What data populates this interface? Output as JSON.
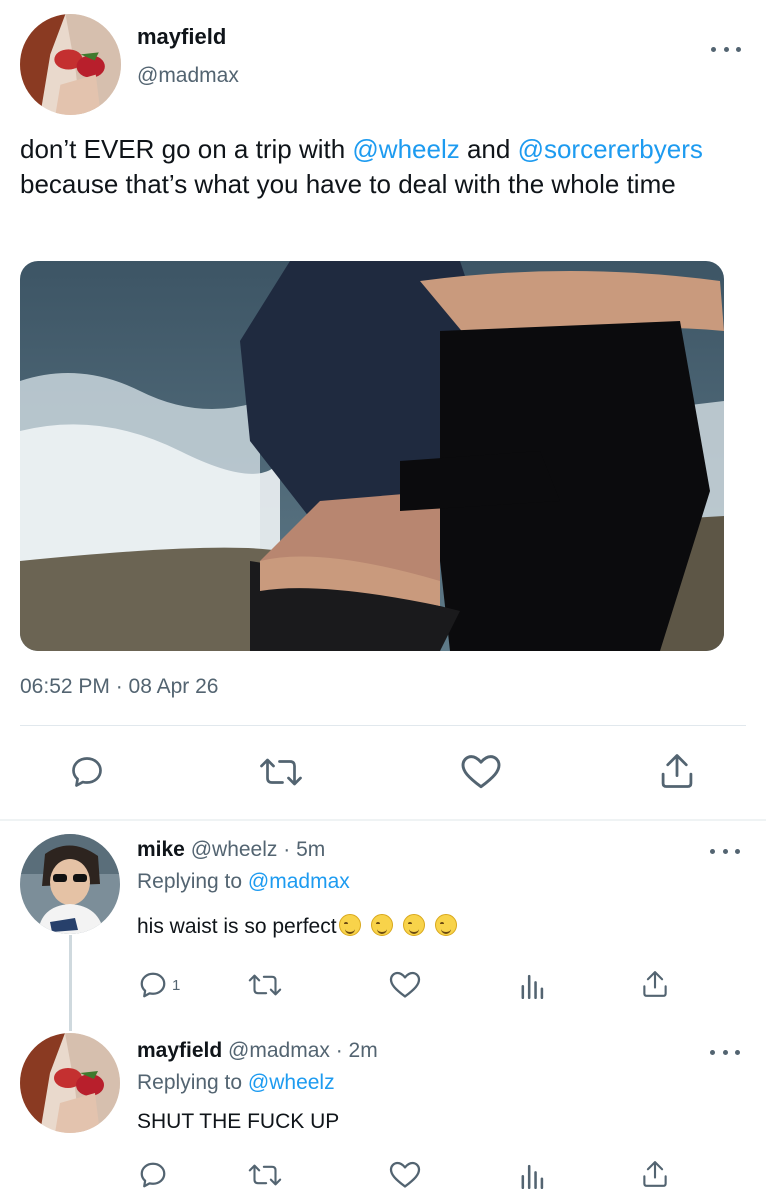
{
  "main_tweet": {
    "name": "mayfield",
    "handle": "@madmax",
    "text_parts": {
      "a": "don’t EVER go on a trip with ",
      "m1": "@wheelz",
      "b": " and ",
      "m2": "@sorcererbyers",
      "c": " because that’s what you have to deal with the whole time"
    },
    "timestamp": "06:52 PM · 08 Apr 26",
    "actions": [
      "reply-icon",
      "retweet-icon",
      "like-icon",
      "share-icon"
    ]
  },
  "replies": [
    {
      "name": "mike",
      "handle": "@wheelz",
      "time": "· 5m",
      "replying_prefix": "Replying to ",
      "replying_to": "@madmax",
      "text": "his waist is so perfect",
      "emoji_count": 4,
      "reply_count": "1"
    },
    {
      "name": "mayfield",
      "handle": "@madmax",
      "time": "· 2m",
      "replying_prefix": "Replying to ",
      "replying_to": "@wheelz",
      "text": "SHUT THE FUCK UP"
    }
  ],
  "colors": {
    "accent": "#1d9bf0",
    "secondary_text": "#536471",
    "primary_text": "#0f1419"
  }
}
